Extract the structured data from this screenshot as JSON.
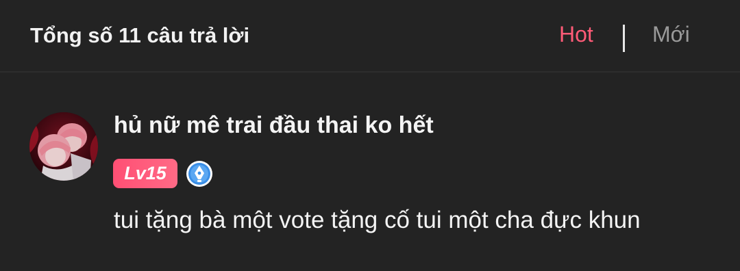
{
  "header": {
    "total_answers": "Tổng số 11 câu trả lời",
    "sort_options": [
      "Hot",
      "Mới"
    ],
    "active_sort": "Hot"
  },
  "comment": {
    "username": "hủ nữ mê trai đầu thai ko hết",
    "level": "Lv15",
    "text": "tui tặng bà một vote tặng cố tui một cha đực khun",
    "avatar_icon": "avatar-anime-image",
    "verified_icon": "verified-quill-icon"
  },
  "colors": {
    "background": "#232323",
    "active_sort": "#ff5b77",
    "inactive_sort": "#9a9a9a",
    "level_badge": "#ff5a7c",
    "verify_badge": "#3a8ee6"
  }
}
